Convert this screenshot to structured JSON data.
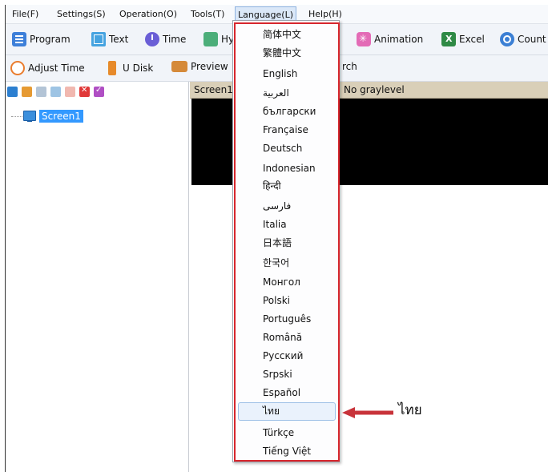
{
  "menubar": {
    "items": [
      "File(F)",
      "Settings(S)",
      "Operation(O)",
      "Tools(T)",
      "Language(L)",
      "Help(H)"
    ]
  },
  "toolbar1": {
    "program": "Program",
    "text": "Text",
    "time": "Time",
    "hy": "Hy",
    "animation": "Animation",
    "excel": "Excel",
    "count": "Count"
  },
  "toolbar2": {
    "adjust_time": "Adjust Time",
    "u_disk": "U Disk",
    "preview": "Preview",
    "search_partial": "rch"
  },
  "tree": {
    "screen1": "Screen1"
  },
  "screen_header": {
    "name": "Screen1",
    "graylevel": "No graylevel"
  },
  "language_menu": {
    "items": [
      "简体中文",
      "繁體中文",
      "English",
      "العربية",
      "български",
      "Française",
      "Deutsch",
      "Indonesian",
      "हिन्दी",
      "فارسی",
      "Italia",
      "日本語",
      "한국어",
      "Монгол",
      "Polski",
      "Português",
      "Română",
      "Русский",
      "Srpski",
      "Español",
      "ไทย",
      "Türkçe",
      "Tiếng Việt"
    ],
    "selected_index": 20
  },
  "annotation": {
    "label": "ไทย",
    "highlight_color": "#d7262d"
  }
}
